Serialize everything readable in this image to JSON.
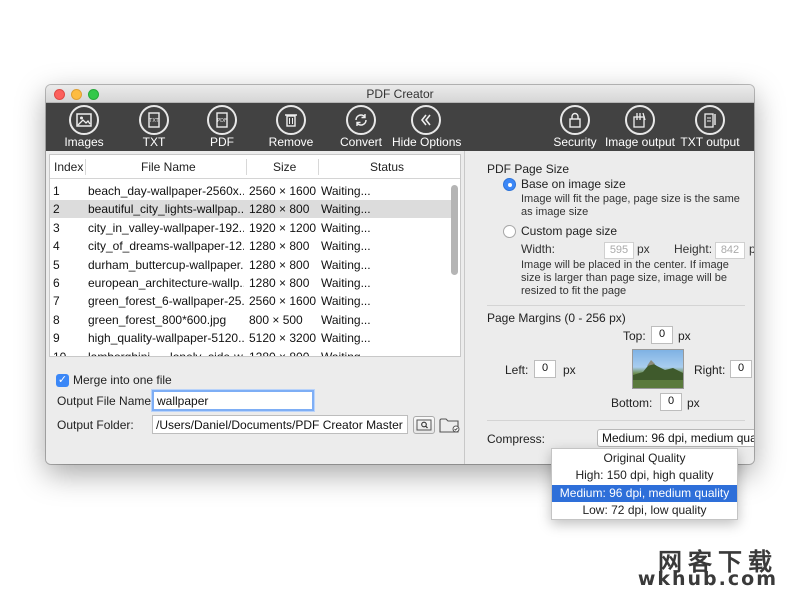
{
  "window": {
    "title": "PDF Creator"
  },
  "toolbar": {
    "items": [
      {
        "label": "Images",
        "icon": "image-icon"
      },
      {
        "label": "TXT",
        "icon": "txt-file-icon"
      },
      {
        "label": "PDF",
        "icon": "pdf-file-icon"
      },
      {
        "label": "Remove",
        "icon": "trash-icon"
      },
      {
        "label": "Convert",
        "icon": "convert-icon"
      },
      {
        "label": "Hide Options",
        "icon": "double-chevron-left-icon"
      },
      {
        "label": "Security",
        "icon": "lock-icon"
      },
      {
        "label": "Image output",
        "icon": "image-output-icon"
      },
      {
        "label": "TXT output",
        "icon": "txt-output-icon"
      }
    ]
  },
  "table": {
    "headers": {
      "index": "Index",
      "name": "File Name",
      "size": "Size",
      "status": "Status"
    },
    "rows": [
      {
        "index": "1",
        "name": "beach_day-wallpaper-2560x...",
        "size": "2560 × 1600",
        "status": "Waiting..."
      },
      {
        "index": "2",
        "name": "beautiful_city_lights-wallpap...",
        "size": "1280 × 800",
        "status": "Waiting..."
      },
      {
        "index": "3",
        "name": "city_in_valley-wallpaper-192...",
        "size": "1920 × 1200",
        "status": "Waiting..."
      },
      {
        "index": "4",
        "name": "city_of_dreams-wallpaper-12...",
        "size": "1280 × 800",
        "status": "Waiting..."
      },
      {
        "index": "5",
        "name": "durham_buttercup-wallpaper...",
        "size": "1280 × 800",
        "status": "Waiting..."
      },
      {
        "index": "6",
        "name": "european_architecture-wallp...",
        "size": "1280 × 800",
        "status": "Waiting..."
      },
      {
        "index": "7",
        "name": "green_forest_6-wallpaper-25...",
        "size": "2560 × 1600",
        "status": "Waiting..."
      },
      {
        "index": "8",
        "name": "green_forest_800*600.jpg",
        "size": "800 × 500",
        "status": "Waiting..."
      },
      {
        "index": "9",
        "name": "high_quality-wallpaper-5120...",
        "size": "5120 × 3200",
        "status": "Waiting..."
      },
      {
        "index": "10",
        "name": "lamborghini___lonely_side-w...",
        "size": "1280 × 800",
        "status": "Waiting..."
      }
    ],
    "selected_row": 1
  },
  "output": {
    "merge_label": "Merge into one file",
    "merge_checked": true,
    "file_name_label": "Output File Name:",
    "file_name_value": "wallpaper",
    "folder_label": "Output Folder:",
    "folder_value": "/Users/Daniel/Documents/PDF Creator Master"
  },
  "page_size": {
    "title": "PDF Page Size",
    "base_label": "Base on image size",
    "base_desc_1": "Image will fit the page, page size is the same",
    "base_desc_2": "as image size",
    "custom_label": "Custom page size",
    "width_label": "Width:",
    "width_value": "595",
    "height_label": "Height:",
    "height_value": "842",
    "unit": "px",
    "custom_desc_1": "Image will be placed in the center. If image",
    "custom_desc_2": "size is larger than page size, image will be",
    "custom_desc_3": "resized to fit the page"
  },
  "margins": {
    "title": "Page Margins (0 - 256 px)",
    "top_label": "Top:",
    "top_value": "0",
    "left_label": "Left:",
    "left_value": "0",
    "right_label": "Right:",
    "right_value": "0",
    "bottom_label": "Bottom:",
    "bottom_value": "0",
    "unit": "px"
  },
  "compress": {
    "label": "Compress:",
    "selected": "Medium: 96 dpi, medium quality",
    "options": [
      "Original Quality",
      "High: 150 dpi, high quality",
      "Medium: 96 dpi, medium quality",
      "Low: 72 dpi, low quality"
    ],
    "active_index": 2
  },
  "watermark": {
    "line1": "网客下载",
    "line2": "wkhub.com"
  },
  "colors": {
    "toolbar_bg": "#424242",
    "accent": "#3b87f7",
    "selection": "#2e6fd9"
  }
}
